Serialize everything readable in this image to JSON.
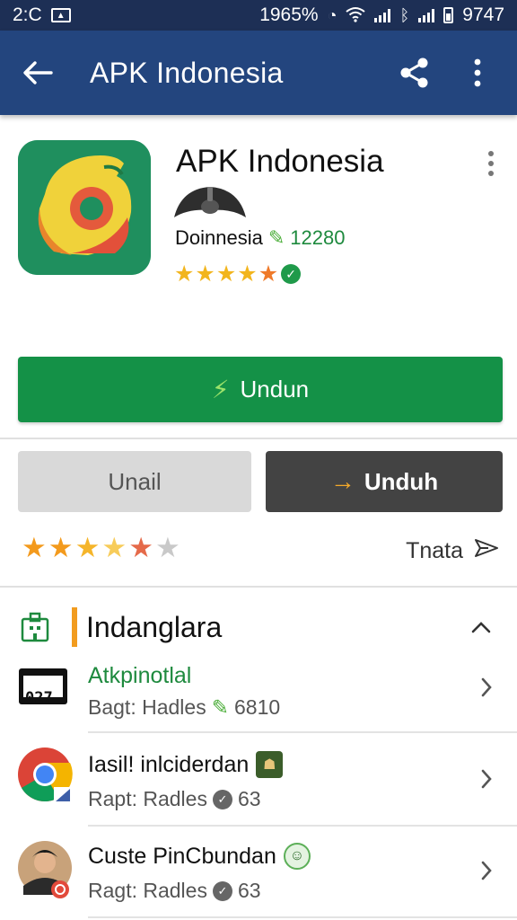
{
  "status_bar": {
    "time_left": "2:C",
    "battery_percent": "1965%",
    "time_right": "9747",
    "icons": [
      "image-box-icon",
      "alarm-icon",
      "wifi-icon",
      "signal-icon",
      "bluetooth-icon",
      "signal-icon",
      "battery-icon"
    ]
  },
  "toolbar": {
    "title": "APK Indonesia",
    "back_icon": "arrow-left-icon",
    "share_icon": "share-icon",
    "menu_icon": "more-vertical-icon"
  },
  "app": {
    "title": "APK Indonesia",
    "developer": "Doinnesia",
    "developer_count": "12280",
    "rating_stars": 5
  },
  "buttons": {
    "download_label": "Undun",
    "unail_label": "Unail",
    "unduh_label": "Unduh"
  },
  "rating": {
    "stars": 4.5,
    "share_label": "Tnata"
  },
  "section": {
    "title": "Indanglara",
    "items": [
      {
        "title": "Atkpinotlal",
        "subtitle": "Bagt:  Hadles",
        "count": "6810",
        "icon_text": "027"
      },
      {
        "title": "Iasil! inlciderdan",
        "subtitle": "Rapt:  Radles",
        "count": "63"
      },
      {
        "title": "Custe PinCbundan",
        "subtitle": "Ragt:  Radles",
        "count": "63"
      }
    ]
  },
  "colors": {
    "status_bar": "#1d2f55",
    "toolbar": "#23457e",
    "primary_green": "#149147",
    "dark_button": "#434343",
    "accent_orange": "#f29c1f",
    "star": "#f2b51d"
  }
}
